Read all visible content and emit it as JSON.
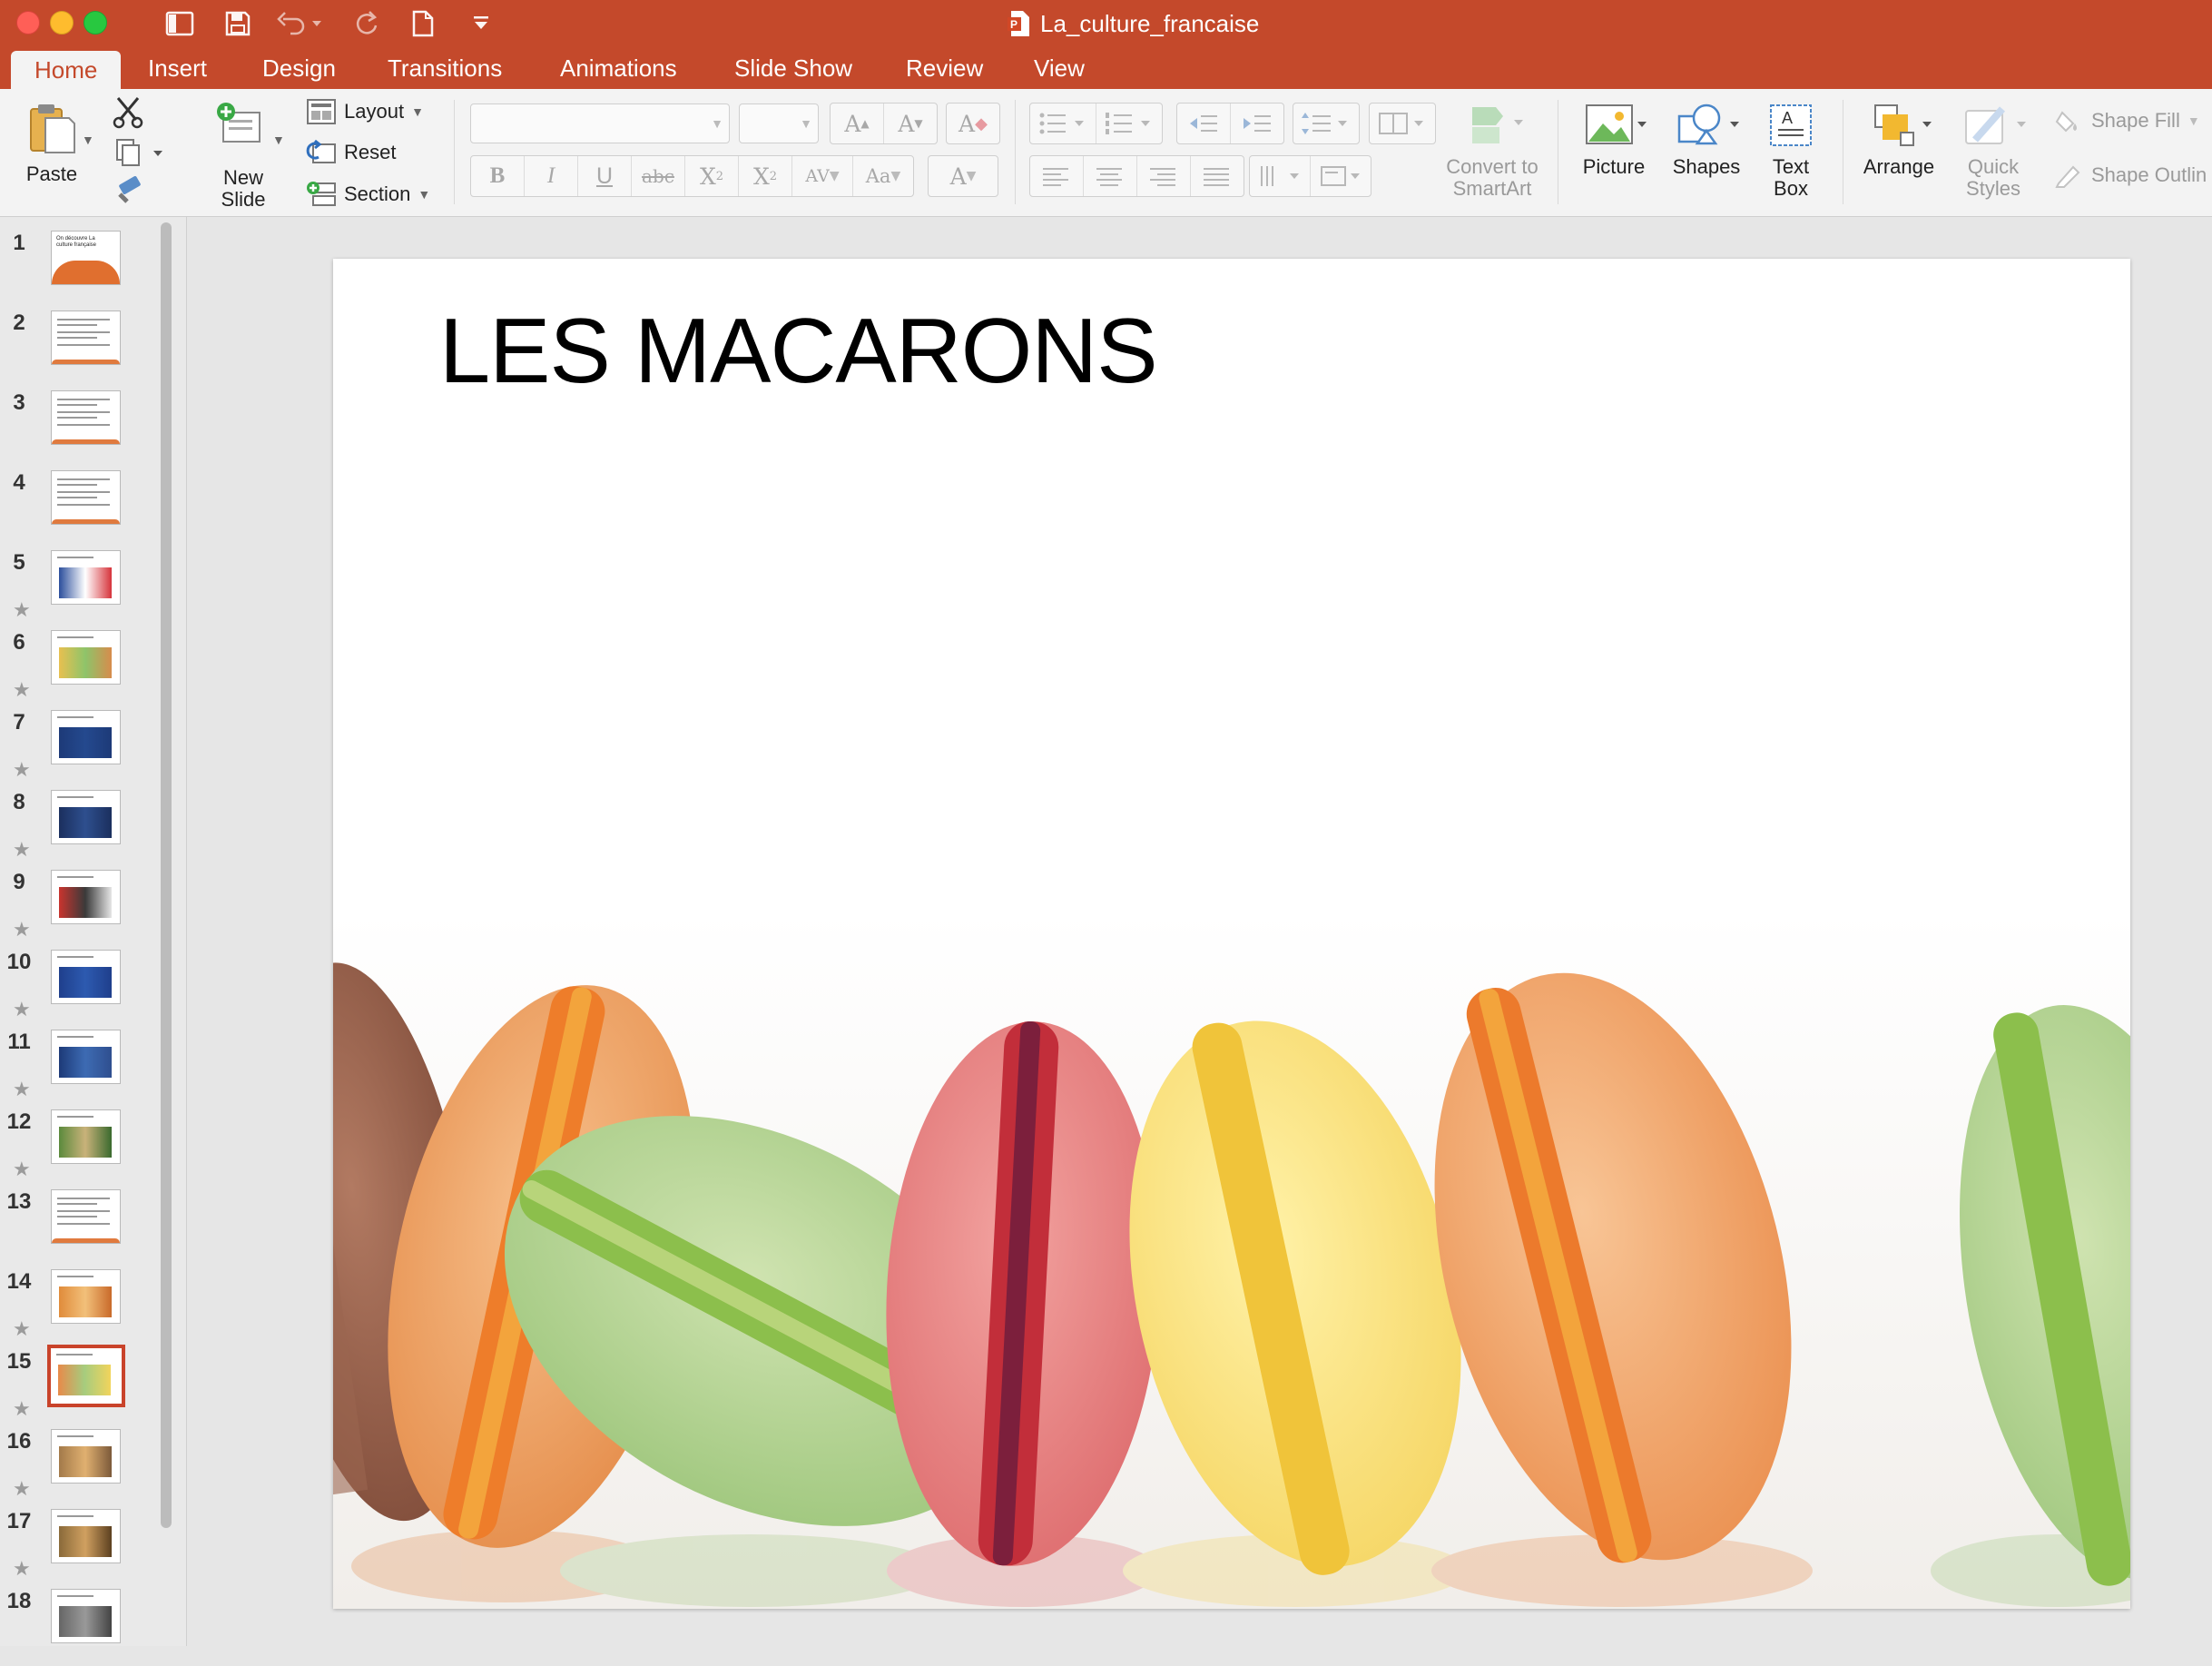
{
  "window": {
    "document_title": "La_culture_francaise"
  },
  "tabs": [
    {
      "label": "Home",
      "active": true
    },
    {
      "label": "Insert"
    },
    {
      "label": "Design"
    },
    {
      "label": "Transitions"
    },
    {
      "label": "Animations"
    },
    {
      "label": "Slide Show"
    },
    {
      "label": "Review"
    },
    {
      "label": "View"
    }
  ],
  "ribbon": {
    "paste": "Paste",
    "new_slide_1": "New",
    "new_slide_2": "Slide",
    "layout": "Layout",
    "reset": "Reset",
    "section": "Section",
    "convert_1": "Convert to",
    "convert_2": "SmartArt",
    "picture": "Picture",
    "shapes": "Shapes",
    "textbox_1": "Text",
    "textbox_2": "Box",
    "arrange": "Arrange",
    "quick_styles_1": "Quick",
    "quick_styles_2": "Styles",
    "shape_fill": "Shape Fill",
    "shape_outline": "Shape Outlin"
  },
  "thumbnails": [
    {
      "num": "1",
      "star": false,
      "title": "On découvre La culture française"
    },
    {
      "num": "2",
      "star": false
    },
    {
      "num": "3",
      "star": false
    },
    {
      "num": "4",
      "star": false
    },
    {
      "num": "5",
      "star": true
    },
    {
      "num": "6",
      "star": true
    },
    {
      "num": "7",
      "star": true
    },
    {
      "num": "8",
      "star": true
    },
    {
      "num": "9",
      "star": true
    },
    {
      "num": "10",
      "star": true
    },
    {
      "num": "11",
      "star": true
    },
    {
      "num": "12",
      "star": true
    },
    {
      "num": "13",
      "star": false
    },
    {
      "num": "14",
      "star": true
    },
    {
      "num": "15",
      "star": true,
      "selected": true
    },
    {
      "num": "16",
      "star": true
    },
    {
      "num": "17",
      "star": true
    },
    {
      "num": "18",
      "star": false
    }
  ],
  "slide": {
    "title": "LES MACARONS"
  },
  "colors": {
    "accent": "#c4492b",
    "selection": "#c9432a"
  }
}
